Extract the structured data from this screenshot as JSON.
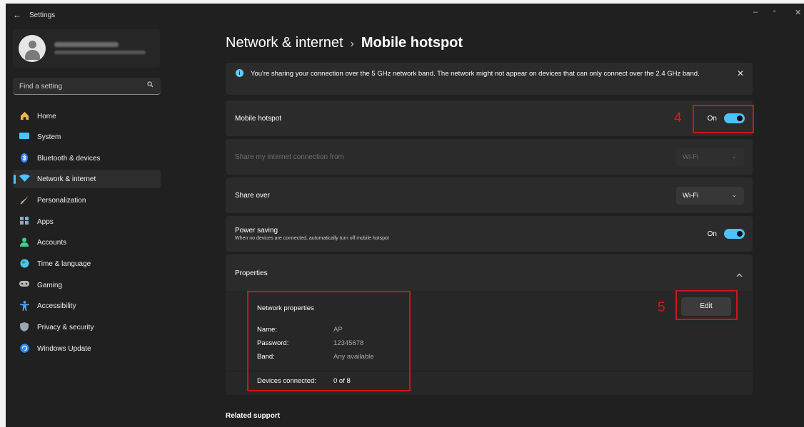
{
  "window": {
    "app_title": "Settings",
    "back_glyph": "←",
    "controls": {
      "minimize": "–",
      "maximize": "▫",
      "close": "✕"
    }
  },
  "search": {
    "placeholder": "Find a setting",
    "icon": "search-icon"
  },
  "sidebar": {
    "items": [
      {
        "label": "Home",
        "icon": "home-icon",
        "color": "#f0b84a",
        "selected": false
      },
      {
        "label": "System",
        "icon": "system-icon",
        "color": "#4cc2ff",
        "selected": false
      },
      {
        "label": "Bluetooth & devices",
        "icon": "bluetooth-icon",
        "color": "#3a86ff",
        "selected": false
      },
      {
        "label": "Network & internet",
        "icon": "wifi-icon",
        "color": "#4cc2ff",
        "selected": true
      },
      {
        "label": "Personalization",
        "icon": "brush-icon",
        "color": "#f2a65a",
        "selected": false
      },
      {
        "label": "Apps",
        "icon": "apps-icon",
        "color": "#9aa6b2",
        "selected": false
      },
      {
        "label": "Accounts",
        "icon": "accounts-icon",
        "color": "#3fcf8e",
        "selected": false
      },
      {
        "label": "Time & language",
        "icon": "globe-icon",
        "color": "#4cc2ff",
        "selected": false
      },
      {
        "label": "Gaming",
        "icon": "gamepad-icon",
        "color": "#b8b8b8",
        "selected": false
      },
      {
        "label": "Accessibility",
        "icon": "accessibility-icon",
        "color": "#4ca8ff",
        "selected": false
      },
      {
        "label": "Privacy & security",
        "icon": "shield-icon",
        "color": "#9aa6b2",
        "selected": false
      },
      {
        "label": "Windows Update",
        "icon": "update-icon",
        "color": "#2d8cf0",
        "selected": false
      }
    ]
  },
  "breadcrumb": {
    "parent": "Network & internet",
    "separator": "›",
    "current": "Mobile hotspot"
  },
  "info_banner": {
    "text": "You're sharing your connection over the 5 GHz network band. The network might not appear on devices that can only connect over the 2.4 GHz band.",
    "close_glyph": "✕"
  },
  "settings": {
    "mobile_hotspot": {
      "label": "Mobile hotspot",
      "state": "On",
      "enabled": true
    },
    "share_from": {
      "label": "Share my internet connection from",
      "value": "Wi-Fi",
      "disabled": true
    },
    "share_over": {
      "label": "Share over",
      "value": "Wi-Fi"
    },
    "power_saving": {
      "label": "Power saving",
      "description": "When no devices are connected, automatically turn off mobile hotspot",
      "state": "On",
      "enabled": true
    },
    "properties": {
      "label": "Properties",
      "expanded": true,
      "heading": "Network properties",
      "edit_label": "Edit",
      "name_label": "Name:",
      "name_value": "AP",
      "password_label": "Password:",
      "password_value": "12345678",
      "band_label": "Band:",
      "band_value": "Any available",
      "devices_label": "Devices connected:",
      "devices_value": "0 of 8"
    }
  },
  "annotations": {
    "step4": "4",
    "step5": "5",
    "color": "#d0141c"
  },
  "related": {
    "label": "Related support"
  },
  "colors": {
    "accent": "#4cc2ff",
    "background": "#202020",
    "card": "#2b2b2b"
  }
}
